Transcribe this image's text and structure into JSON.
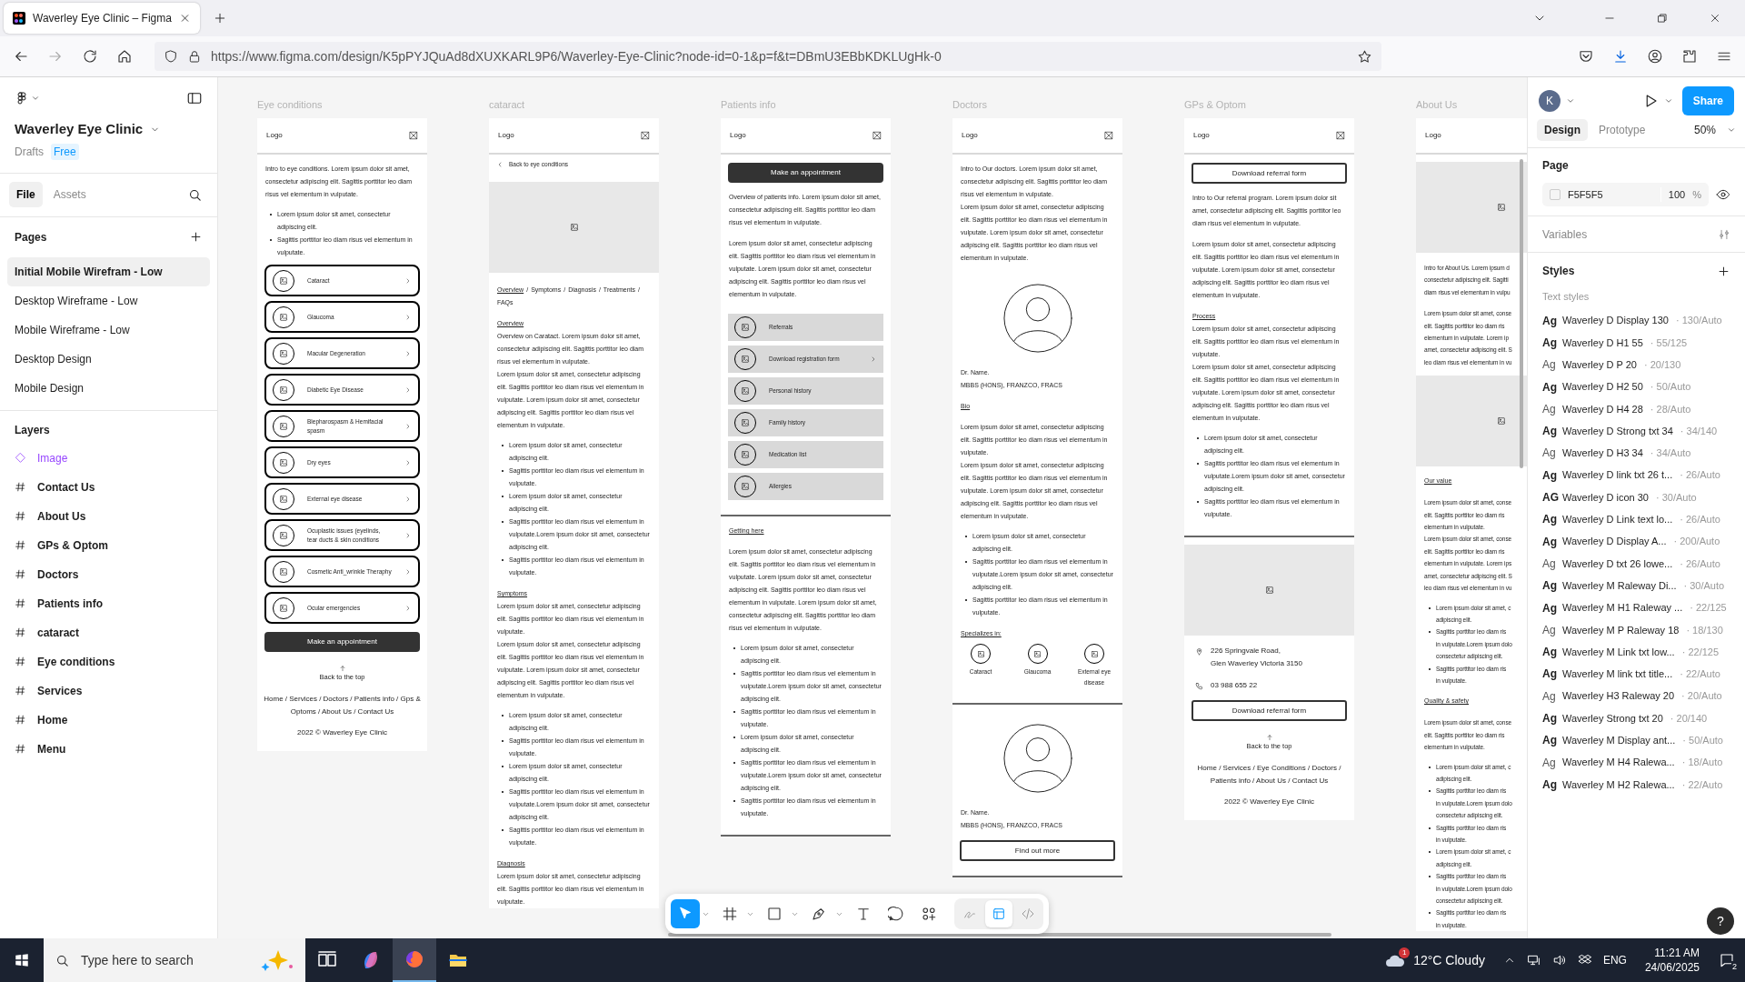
{
  "browser": {
    "tab_title": "Waverley Eye Clinic – Figma",
    "url": "https://www.figma.com/design/K5pPYJQuAd8dXUXKARL9P6/Waverley-Eye-Clinic?node-id=0-1&p=f&t=DBmU3EBbKDKLUgHk-0"
  },
  "file": {
    "name": "Waverley Eye Clinic",
    "location": "Drafts",
    "plan": "Free"
  },
  "left_tabs": [
    {
      "label": "File",
      "selected": true
    },
    {
      "label": "Assets",
      "selected": false
    }
  ],
  "pages": {
    "title": "Pages",
    "items": [
      {
        "label": "Initial Mobile Wirefram - Low",
        "selected": true
      },
      {
        "label": "Desktop Wireframe - Low",
        "selected": false
      },
      {
        "label": "Mobile Wireframe - Low",
        "selected": false
      },
      {
        "label": "Desktop Design",
        "selected": false
      },
      {
        "label": "Mobile Design",
        "selected": false
      }
    ]
  },
  "layers": {
    "title": "Layers",
    "items": [
      {
        "label": "Image",
        "kind": "component"
      },
      {
        "label": "Contact Us",
        "kind": "frame"
      },
      {
        "label": "About Us",
        "kind": "frame"
      },
      {
        "label": "GPs & Optom",
        "kind": "frame"
      },
      {
        "label": "Doctors",
        "kind": "frame"
      },
      {
        "label": "Patients info",
        "kind": "frame"
      },
      {
        "label": "cataract",
        "kind": "frame"
      },
      {
        "label": "Eye conditions",
        "kind": "frame"
      },
      {
        "label": "Services",
        "kind": "frame"
      },
      {
        "label": "Home",
        "kind": "frame"
      },
      {
        "label": "Menu",
        "kind": "frame"
      }
    ]
  },
  "frames": [
    {
      "title": "Eye conditions",
      "blocks": [
        {
          "kind": "header",
          "logo": "Logo",
          "close_icon": true
        },
        {
          "kind": "text",
          "text": "Intro to eye conditions. Lorem ipsum dolor sit amet, consectetur adipiscing elit. Sagittis porttitor leo diam risus vel elementum in vulputate."
        },
        {
          "kind": "bullets",
          "items": [
            "Lorem ipsum dolor sit amet, consectetur adipiscing elit.",
            "Sagittis porttitor leo diam risus vel elementum in vulputate."
          ]
        },
        {
          "kind": "outline_cards",
          "items": [
            {
              "label": "Cataract",
              "chevron": true
            },
            {
              "label": "Glaucoma",
              "chevron": true
            },
            {
              "label": "Macular Degeneration",
              "chevron": true
            },
            {
              "label": "Diabetic Eye Disease",
              "chevron": true
            },
            {
              "label": "Blepharospasm & Hemifacial spasm",
              "chevron": true
            },
            {
              "label": "Dry eyes",
              "chevron": true
            },
            {
              "label": "External eye disease",
              "chevron": true
            },
            {
              "label": "Ocuplastic issues (eyelinds, tear ducts & skin conditions",
              "chevron": true
            },
            {
              "label": "Cosmetic Anti_wrinkle Theraphy",
              "chevron": true
            },
            {
              "label": "Ocular emergencies",
              "chevron": true
            }
          ]
        },
        {
          "kind": "dark_button",
          "label": "Make an appointment"
        },
        {
          "kind": "back_top",
          "label": "Back to the top"
        },
        {
          "kind": "footer",
          "text": "Home / Services / Doctors / Patients info / Gps & Optoms / About Us / Contact Us"
        },
        {
          "kind": "copyright",
          "text": "2022 © Waverley Eye Clinic"
        }
      ]
    },
    {
      "title": "cataract",
      "blocks": [
        {
          "kind": "header",
          "logo": "Logo",
          "close_icon": true
        },
        {
          "kind": "back_link",
          "label": "Back to eye conditions"
        },
        {
          "kind": "image"
        },
        {
          "kind": "tabs",
          "separator": "/",
          "items": [
            {
              "label": "Overview",
              "selected": true
            },
            {
              "label": "Symptoms",
              "selected": false
            },
            {
              "label": "Diagnosis",
              "selected": false
            },
            {
              "label": "Treatments",
              "selected": false
            },
            {
              "label": "FAQs",
              "selected": false
            }
          ]
        },
        {
          "kind": "heading",
          "text": "Overview"
        },
        {
          "kind": "text_tight",
          "text": "Overview on Caratact. Lorem ipsum dolor sit amet, consectetur adipiscing elit. Sagittis porttitor leo diam risus vel elementum in vulputate."
        },
        {
          "kind": "text_tight",
          "text": "Lorem ipsum dolor sit amet, consectetur adipiscing elit. Sagittis porttitor leo diam risus vel elementum in vulputate. Lorem ipsum dolor sit amet, consectetur adipiscing elit. Sagittis porttitor leo diam risus vel elementum in vulputate."
        },
        {
          "kind": "bullets",
          "items": [
            "Lorem ipsum dolor sit amet, consectetur adipiscing elit.",
            "Sagittis porttitor leo diam risus vel elementum in vulputate.",
            "Lorem ipsum dolor sit amet, consectetur adipiscing elit.",
            "Sagittis porttitor leo diam risus vel elementum in vulputate.Lorem ipsum dolor sit amet, consectetur adipiscing elit.",
            "Sagittis porttitor leo diam risus vel elementum in vulputate."
          ]
        },
        {
          "kind": "heading",
          "text": "Symptoms"
        },
        {
          "kind": "text_tight",
          "text": "Lorem ipsum dolor sit amet, consectetur adipiscing elit. Sagittis porttitor leo diam risus vel elementum in vulputate."
        },
        {
          "kind": "text_tight",
          "text": "Lorem ipsum dolor sit amet, consectetur adipiscing elit. Sagittis porttitor leo diam risus vel elementum in vulputate. Lorem ipsum dolor sit amet, consectetur adipiscing elit. Sagittis porttitor leo diam risus vel elementum in vulputate."
        },
        {
          "kind": "bullets",
          "items": [
            "Lorem ipsum dolor sit amet, consectetur adipiscing elit.",
            "Sagittis porttitor leo diam risus vel elementum in vulputate.",
            "Lorem ipsum dolor sit amet, consectetur adipiscing elit.",
            "Sagittis porttitor leo diam risus vel elementum in vulputate.Lorem ipsum dolor sit amet, consectetur adipiscing elit.",
            "Sagittis porttitor leo diam risus vel elementum in vulputate."
          ]
        },
        {
          "kind": "heading",
          "text": "Diagnosis"
        },
        {
          "kind": "text_tight",
          "text": "Lorem ipsum dolor sit amet, consectetur adipiscing elit. Sagittis porttitor leo diam risus vel elementum in vulputate."
        }
      ]
    },
    {
      "title": "Patients info",
      "blocks": [
        {
          "kind": "header",
          "logo": "Logo",
          "close_icon": true
        },
        {
          "kind": "dark_button",
          "label": "Make an appointment"
        },
        {
          "kind": "text",
          "text": "Overview of patients info. Lorem ipsum dolor sit amet, consectetur adipiscing elit. Sagittis porttitor leo diam risus vel elementum in vulputate."
        },
        {
          "kind": "text",
          "text": "Lorem ipsum dolor sit amet, consectetur adipiscing elit. Sagittis porttitor leo diam risus vel elementum in vulputate. Lorem ipsum dolor sit amet, consectetur adipiscing elit. Sagittis porttitor leo diam risus vel elementum in vulputate."
        },
        {
          "kind": "filled_cards",
          "items": [
            {
              "label": "Referrals",
              "chevron": false
            },
            {
              "label": "Download registration form",
              "chevron": true
            },
            {
              "label": "Personal history",
              "chevron": false
            },
            {
              "label": "Family history",
              "chevron": false
            },
            {
              "label": "Medication list",
              "chevron": false
            },
            {
              "label": "Allergies",
              "chevron": false
            }
          ]
        },
        {
          "kind": "divider"
        },
        {
          "kind": "heading",
          "text": "Getting here"
        },
        {
          "kind": "text",
          "text": "Lorem ipsum dolor sit amet, consectetur adipiscing elit. Sagittis porttitor leo diam risus vel elementum in vulputate. Lorem ipsum dolor sit amet, consectetur adipiscing elit. Sagittis porttitor leo diam risus vel elementum in vulputate. Lorem ipsum dolor sit amet, consectetur adipiscing elit. Sagittis porttitor leo diam risus vel elementum in vulputate."
        },
        {
          "kind": "bullets",
          "items": [
            "Lorem ipsum dolor sit amet, consectetur adipiscing elit.",
            "Sagittis porttitor leo diam risus vel elementum in vulputate.Lorem ipsum dolor sit amet, consectetur adipiscing elit.",
            "Sagittis porttitor leo diam risus vel elementum in vulputate.",
            "Lorem ipsum dolor sit amet, consectetur adipiscing elit.",
            "Sagittis porttitor leo diam risus vel elementum in vulputate.Lorem ipsum dolor sit amet, consectetur adipiscing elit.",
            "Sagittis porttitor leo diam risus vel elementum in vulputate."
          ]
        },
        {
          "kind": "divider"
        }
      ]
    },
    {
      "title": "Doctors",
      "blocks": [
        {
          "kind": "header",
          "logo": "Logo",
          "close_icon": true
        },
        {
          "kind": "text",
          "text": "Intro to Our doctors. Lorem ipsum dolor sit amet, consectetur adipiscing elit. Sagittis porttitor leo diam risus vel elementum in vulputate."
        },
        {
          "kind": "text_tight",
          "text": "Lorem ipsum dolor sit amet, consectetur adipiscing elit. Sagittis porttitor leo diam risus vel elementum in vulputate. Lorem ipsum dolor sit amet, consectetur adipiscing elit. Sagittis porttitor leo diam risus vel elementum in vulputate."
        },
        {
          "kind": "avatar"
        },
        {
          "kind": "person",
          "name": "Dr. Name.",
          "credentials": "MBBS (HONS), FRANZCO, FRACS"
        },
        {
          "kind": "heading",
          "text": "Bio"
        },
        {
          "kind": "text",
          "text": "Lorem ipsum dolor sit amet, consectetur adipiscing elit. Sagittis porttitor leo diam risus vel elementum in vulputate."
        },
        {
          "kind": "text_tight",
          "text": "Lorem ipsum dolor sit amet, consectetur adipiscing elit. Sagittis porttitor leo diam risus vel elementum in vulputate. Lorem ipsum dolor sit amet, consectetur adipiscing elit. Sagittis porttitor leo diam risus vel elementum in vulputate."
        },
        {
          "kind": "bullets",
          "items": [
            "Lorem ipsum dolor sit amet, consectetur adipiscing elit.",
            "Sagittis porttitor leo diam risus vel elementum in vulputate.Lorem ipsum dolor sit amet, consectetur adipiscing elit.",
            "Sagittis porttitor leo diam risus vel elementum in vulputate."
          ]
        },
        {
          "kind": "heading",
          "text": "Specializes in:"
        },
        {
          "kind": "specialties",
          "items": [
            "Cataract",
            "Glaucoma",
            "External eye disease"
          ]
        },
        {
          "kind": "divider"
        },
        {
          "kind": "avatar"
        },
        {
          "kind": "person",
          "name": "Dr. Name.",
          "credentials": "MBBS (HONS), FRANZCO, FRACS"
        },
        {
          "kind": "outline_button",
          "label": "Find out more"
        },
        {
          "kind": "divider"
        }
      ]
    },
    {
      "title": "GPs & Optom",
      "blocks": [
        {
          "kind": "header",
          "logo": "Logo",
          "close_icon": true
        },
        {
          "kind": "outline_button",
          "label": "Download referral form"
        },
        {
          "kind": "text",
          "text": "Intro to Our referral program. Lorem ipsum dolor sit amet, consectetur adipiscing elit. Sagittis porttitor leo diam risus vel elementum in vulputate."
        },
        {
          "kind": "text",
          "text": "Lorem ipsum dolor sit amet, consectetur adipiscing elit. Sagittis porttitor leo diam risus vel elementum in vulputate. Lorem ipsum dolor sit amet, consectetur adipiscing elit. Sagittis porttitor leo diam risus vel elementum in vulputate."
        },
        {
          "kind": "heading",
          "text": "Process"
        },
        {
          "kind": "text_tight",
          "text": "Lorem ipsum dolor sit amet, consectetur adipiscing elit. Sagittis porttitor leo diam risus vel elementum in vulputate."
        },
        {
          "kind": "text_tight",
          "text": "Lorem ipsum dolor sit amet, consectetur adipiscing elit. Sagittis porttitor leo diam risus vel elementum in vulputate. Lorem ipsum dolor sit amet, consectetur adipiscing elit. Sagittis porttitor leo diam risus vel elementum in vulputate."
        },
        {
          "kind": "bullets",
          "items": [
            "Lorem ipsum dolor sit amet, consectetur adipiscing elit.",
            "Sagittis porttitor leo diam risus vel elementum in vulputate.Lorem ipsum dolor sit amet, consectetur adipiscing elit.",
            "Sagittis porttitor leo diam risus vel elementum in vulputate."
          ]
        },
        {
          "kind": "divider"
        },
        {
          "kind": "image"
        },
        {
          "kind": "address",
          "lines": [
            "226 Springvale Road,",
            "Glen Waverley Victoria 3150"
          ]
        },
        {
          "kind": "phone",
          "lines": [
            "03 988 655 22"
          ]
        },
        {
          "kind": "outline_button",
          "label": "Download referral form"
        },
        {
          "kind": "back_top",
          "label": "Back to the top"
        },
        {
          "kind": "footer",
          "text": "Home / Services / Eye Conditions / Doctors / Patients info / About Us / Contact Us"
        },
        {
          "kind": "copyright",
          "text": "2022 © Waverley Eye Clinic"
        }
      ]
    },
    {
      "title": "About Us",
      "blocks": [
        {
          "kind": "logo_bar",
          "logo": "Logo"
        },
        {
          "kind": "image"
        },
        {
          "kind": "lines",
          "lines": [
            "Intro for About Us. Lorem ipsum d",
            "consectetur adipiscing elit. Sagitti",
            "diam risus vel elementum in vulpu"
          ]
        },
        {
          "kind": "lines",
          "lines": [
            "Lorem ipsum dolor sit amet, conse",
            "elit. Sagittis porttitor leo diam ris",
            "elementum in vulputate. Lorem ip",
            "amet, consectetur adipiscing elit. S",
            "leo diam risus vel elementum in vu"
          ]
        },
        {
          "kind": "image"
        },
        {
          "kind": "heading",
          "text": "Our value"
        },
        {
          "kind": "lines",
          "lines": [
            "Lorem ipsum dolor sit amet, conse",
            "elit. Sagittis porttitor leo diam ris",
            "elementum in vulputate.",
            "Lorem ipsum dolor sit amet, conse",
            "elit. Sagittis porttitor leo diam ris",
            "elementum in vulputate. Lorem ips",
            "amet, consectetur adipiscing elit. S",
            "leo diam risus vel elementum in vu"
          ]
        },
        {
          "kind": "bullet_lines",
          "items": [
            [
              "Lorem ipsum dolor sit amet, c",
              "adipiscing elit."
            ],
            [
              "Sagittis porttitor leo diam ris",
              "in vulputate.Lorem ipsum dolo",
              "consectetur adipiscing elit."
            ],
            [
              "Sagittis porttitor leo diam ris",
              "in vulputate."
            ]
          ]
        },
        {
          "kind": "heading",
          "text": "Quality & safety"
        },
        {
          "kind": "lines",
          "lines": [
            "Lorem ipsum dolor sit amet, conse",
            "elit. Sagittis porttitor leo diam ris",
            "elementum in vulputate."
          ]
        },
        {
          "kind": "bullet_lines",
          "items": [
            [
              "Lorem ipsum dolor sit amet, c",
              "adipiscing elit."
            ],
            [
              "Sagittis porttitor leo diam ris",
              "in vulputate.Lorem ipsum dolo",
              "consectetur adipiscing elit."
            ],
            [
              "Sagittis porttitor leo diam ris",
              "in vulputate."
            ],
            [
              "Lorem ipsum dolor sit amet, c",
              "adipiscing elit."
            ],
            [
              "Sagittis porttitor leo diam ris",
              "in vulputate.Lorem ipsum dolo",
              "consectetur adipiscing elit."
            ],
            [
              "Sagittis porttitor leo diam ris",
              "in vulputate."
            ]
          ]
        }
      ]
    }
  ],
  "toolbar": {
    "tools": [
      {
        "kind": "move",
        "selected": true
      },
      {
        "kind": "frame",
        "selected": false
      },
      {
        "kind": "shape",
        "selected": false
      },
      {
        "kind": "pen",
        "selected": false
      },
      {
        "kind": "text",
        "selected": false
      },
      {
        "kind": "comment",
        "selected": false
      },
      {
        "kind": "actions",
        "selected": false
      }
    ],
    "modes": [
      {
        "kind": "draw",
        "selected": false
      },
      {
        "kind": "design",
        "selected": true
      },
      {
        "kind": "dev",
        "selected": false
      }
    ]
  },
  "right_panel": {
    "user_initial": "K",
    "share": "Share",
    "tabs": [
      {
        "label": "Design",
        "selected": true
      },
      {
        "label": "Prototype",
        "selected": false
      }
    ],
    "zoom": "50%",
    "page": {
      "title": "Page",
      "color": "F5F5F5",
      "opacity": "100",
      "unit": "%"
    },
    "variables": "Variables",
    "styles": "Styles",
    "text_styles": {
      "title": "Text styles",
      "items": [
        {
          "glyph": "Ag",
          "bold": true,
          "name": "Waverley D Display 130",
          "meta": "· 130/Auto"
        },
        {
          "glyph": "Ag",
          "bold": true,
          "name": "Waverley D H1 55",
          "meta": "· 55/125"
        },
        {
          "glyph": "Ag",
          "bold": false,
          "name": "Waverley D P 20",
          "meta": "· 20/130"
        },
        {
          "glyph": "Ag",
          "bold": true,
          "name": "Waverley D H2 50",
          "meta": "· 50/Auto"
        },
        {
          "glyph": "Ag",
          "bold": false,
          "name": "Waverley D H4 28",
          "meta": "· 28/Auto"
        },
        {
          "glyph": "Ag",
          "bold": true,
          "name": "Waverley D Strong txt 34",
          "meta": "· 34/140"
        },
        {
          "glyph": "Ag",
          "bold": false,
          "name": "Waverley D H3 34",
          "meta": "· 34/Auto"
        },
        {
          "glyph": "Ag",
          "bold": true,
          "name": "Waverley D link txt 26 t...",
          "meta": "· 26/Auto"
        },
        {
          "glyph": "AG",
          "bold": true,
          "name": "Waverley D icon 30",
          "meta": "· 30/Auto"
        },
        {
          "glyph": "Ag",
          "bold": true,
          "name": "Waverley D Link text lo...",
          "meta": "· 26/Auto"
        },
        {
          "glyph": "Ag",
          "bold": true,
          "name": "Waverley D Display A...",
          "meta": "· 200/Auto"
        },
        {
          "glyph": "Ag",
          "bold": false,
          "name": "Waverley D txt 26 lowe...",
          "meta": "· 26/Auto"
        },
        {
          "glyph": "Ag",
          "bold": true,
          "name": "Waverley M Raleway Di...",
          "meta": "· 30/Auto"
        },
        {
          "glyph": "Ag",
          "bold": true,
          "name": "Waverley M H1 Raleway ...",
          "meta": "· 22/125"
        },
        {
          "glyph": "Ag",
          "bold": false,
          "name": "Waverley M P Raleway 18",
          "meta": "· 18/130"
        },
        {
          "glyph": "Ag",
          "bold": true,
          "name": "Waverley M Link txt low...",
          "meta": "· 22/125"
        },
        {
          "glyph": "Ag",
          "bold": true,
          "name": "Waverley M link txt title...",
          "meta": "· 22/Auto"
        },
        {
          "glyph": "Ag",
          "bold": false,
          "name": "Waverley H3 Raleway 20",
          "meta": "· 20/Auto"
        },
        {
          "glyph": "Ag",
          "bold": true,
          "name": "Waverley Strong txt 20",
          "meta": "· 20/140"
        },
        {
          "glyph": "Ag",
          "bold": true,
          "name": "Waverley M Display ant...",
          "meta": "· 50/Auto"
        },
        {
          "glyph": "Ag",
          "bold": false,
          "name": "Waverley M H4 Ralewa...",
          "meta": "· 18/Auto"
        },
        {
          "glyph": "Ag",
          "bold": true,
          "name": "Waverley M H2 Ralewa...",
          "meta": "· 22/Auto"
        }
      ]
    },
    "help": "?"
  },
  "taskbar": {
    "search_placeholder": "Type here to search",
    "apps": [
      {
        "kind": "task_view",
        "selected": false
      },
      {
        "kind": "copilot",
        "selected": false
      },
      {
        "kind": "firefox",
        "selected": true
      },
      {
        "kind": "explorer",
        "selected": false
      }
    ],
    "weather": {
      "badge": "1",
      "text": "12°C Cloudy"
    },
    "language": "ENG",
    "time": "11:21 AM",
    "date": "24/06/2025",
    "notifications": "2"
  }
}
